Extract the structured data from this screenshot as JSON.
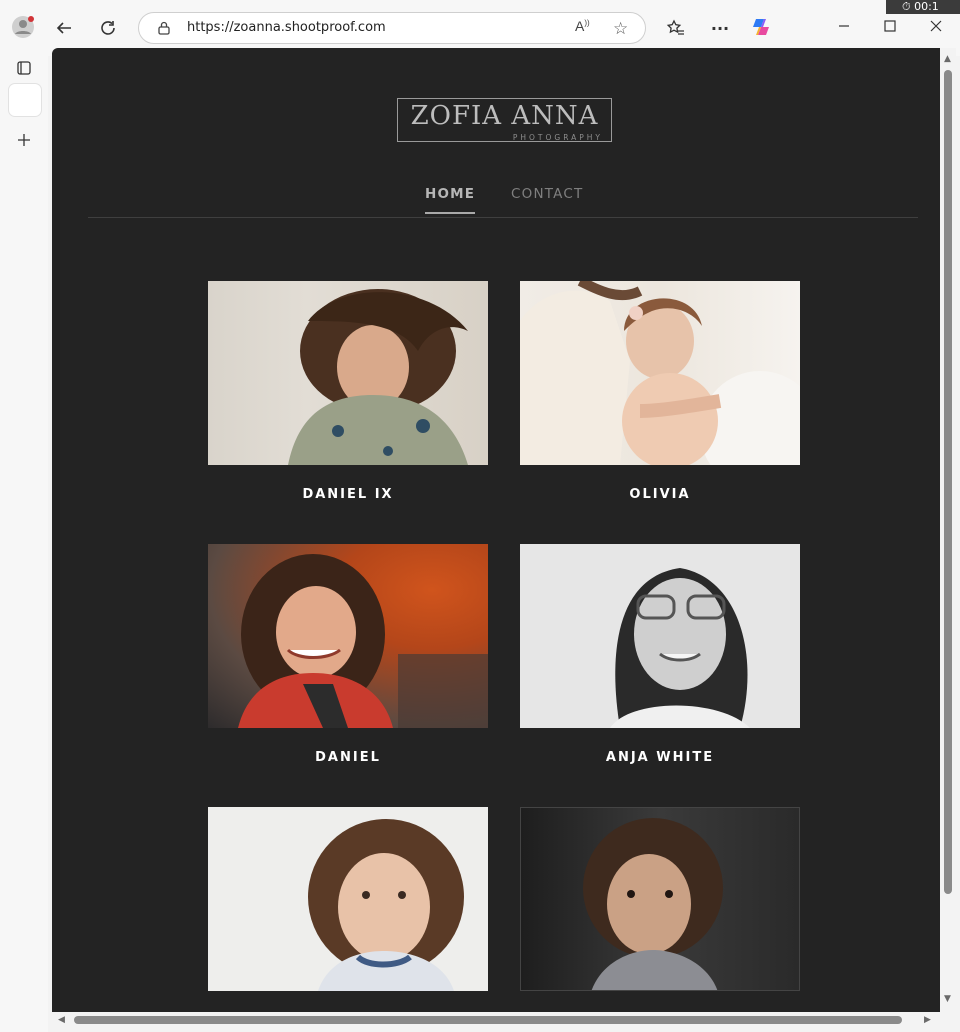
{
  "browser": {
    "url": "https://zoanna.shootproof.com",
    "timer": "00:1",
    "read_aloud": "A",
    "icons": [
      "profile-icon",
      "back-arrow-icon",
      "refresh-icon",
      "lock-icon",
      "read-aloud-icon",
      "favorite-star-icon",
      "favorites-list-icon",
      "more-icon",
      "copilot-icon",
      "minimize-icon",
      "maximize-icon",
      "close-icon",
      "tab-icon",
      "add-tab-icon"
    ]
  },
  "site": {
    "logo_name": "ZOFIA ANNA",
    "logo_sub": "PHOTOGRAPHY",
    "nav": {
      "home": "HOME",
      "contact": "CONTACT"
    }
  },
  "galleries": [
    {
      "title": "DANIEL IX"
    },
    {
      "title": "OLIVIA"
    },
    {
      "title": "DANIEL"
    },
    {
      "title": "ANJA WHITE"
    },
    {
      "title": ""
    },
    {
      "title": ""
    }
  ],
  "colors": {
    "page_background": "#232323",
    "caption_text": "#ffffff",
    "nav_active": "#b6b6b6",
    "nav_inactive": "#7f7f7f"
  }
}
